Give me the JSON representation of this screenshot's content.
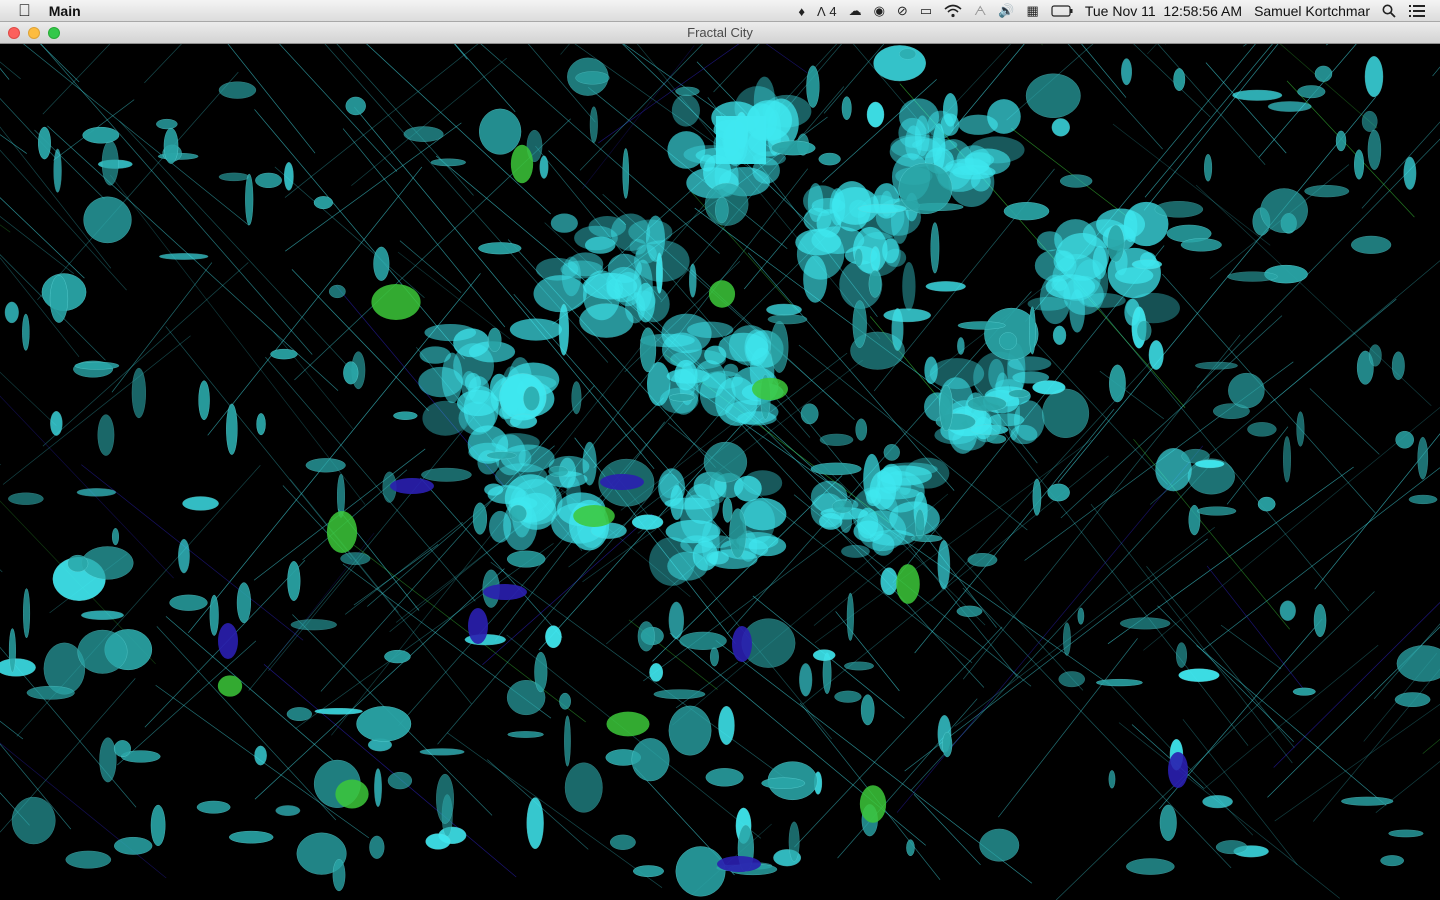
{
  "menubar": {
    "apple_icon": "apple-logo-icon",
    "app_name": "Main",
    "status": {
      "notification_icon": "bell-icon",
      "adobe_badge": "4",
      "cloud_icon": "cloud-icon",
      "airdrop_icon": "podcast-icon",
      "timemachine_icon": "clock-history-icon",
      "airplay_icon": "airplay-icon",
      "wifi_icon": "wifi-icon",
      "bluetooth_icon": "bluetooth-icon",
      "volume_icon": "volume-icon",
      "calendar_icon": "calendar-icon",
      "battery_icon": "battery-icon"
    },
    "clock": "Tue Nov 11  12:58:56 AM",
    "user": "Samuel Kortchmar",
    "search_icon": "spotlight-search-icon",
    "list_icon": "notification-center-icon"
  },
  "window": {
    "title": "Fractal City"
  },
  "scene": {
    "background": "#000000",
    "colors": {
      "cyan": "#3fe8f0",
      "teal": "#2aa6a8",
      "green": "#3cc83a",
      "blue": "#2a1fb0",
      "line": "#3fd0d8"
    }
  }
}
